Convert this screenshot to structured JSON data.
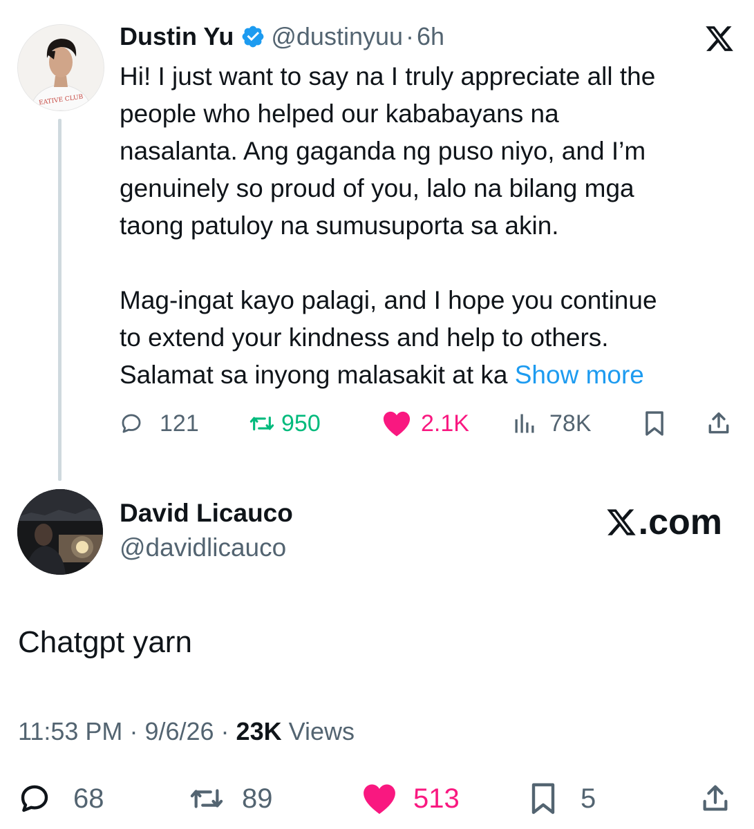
{
  "quoted_tweet": {
    "author_name": "Dustin Yu",
    "handle": "@dustinyuu",
    "separator": "·",
    "time": "6h",
    "avatar_shirt_text": "EATIVE CLUB",
    "body_lines": [
      "Hi! I just want to say na I truly appreciate all the",
      "people who helped our kababayans na",
      "nasalanta. Ang gaganda ng puso niyo, and I’m",
      "genuinely so proud of you, lalo na bilang mga",
      "taong patuloy na sumusuporta sa akin."
    ],
    "body_lines_2": [
      "Mag-ingat kayo palagi, and I hope you continue",
      "to extend your kindness and help to others."
    ],
    "last_line": "Salamat sa inyong malasakit at ka ",
    "show_more": "Show more",
    "replies": "121",
    "reposts": "950",
    "likes": "2.1K",
    "views": "78K",
    "icons": {
      "reply": "reply-icon",
      "repost": "repost-icon",
      "like": "heart-icon",
      "views": "views-icon",
      "bookmark": "bookmark-icon",
      "share": "share-icon",
      "platform": "x-logo-icon"
    }
  },
  "reply_tweet": {
    "author_name": "David Licauco",
    "handle": "@davidlicauco",
    "platform_label": ".com",
    "text": "Chatgpt yarn",
    "time": "11:53 PM",
    "date": "9/6/26",
    "views_count": "23K",
    "views_label": "Views",
    "replies": "68",
    "reposts": "89",
    "likes": "513",
    "bookmarks": "5"
  },
  "colors": {
    "text": "#0f1419",
    "secondary": "#536471",
    "link": "#1d9bf0",
    "repost": "#00ba7c",
    "like": "#f91880",
    "thread_line": "#cfd9de"
  }
}
